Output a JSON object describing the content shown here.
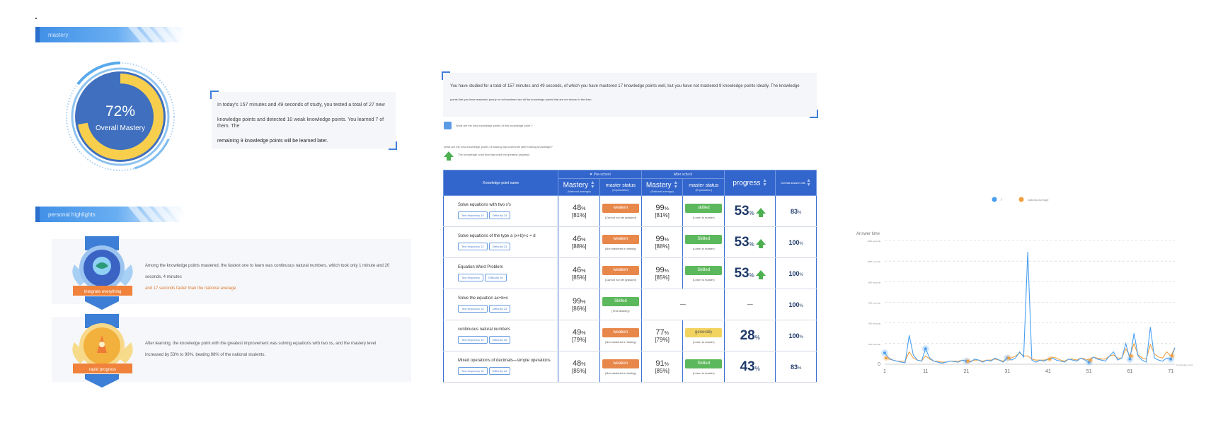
{
  "left": {
    "section1_title": "mastery",
    "gauge": {
      "value": "72%",
      "label": "Overall Mastery",
      "fraction": 0.72
    },
    "summary": [
      "In today's 157 minutes and 49 seconds of study, you tested a total of 27 new",
      "knowledge points and detected 10 weak knowledge points. You learned 7 of them. The",
      "remaining 9 knowledge points will be learned later."
    ],
    "section2_title": "personal highlights",
    "highlights": [
      {
        "badge": "Integrate everything",
        "text": [
          "Among the knowledge points mastered, the fastest one to learn was continuous natural numbers, which took only 1 minute and 20 seconds, 4 minutes",
          "and 17 seconds faster than the national average"
        ]
      },
      {
        "badge": "rapid progress",
        "text": [
          "After learning, the knowledge point with the greatest improvement was solving equations with two xs, and the mastery level",
          "increased by 53% to 99%, beating 98% of the national students."
        ]
      }
    ]
  },
  "middle": {
    "summary": [
      "You have studied for a total of 157 minutes and 49 seconds, of which you have mastered 17 knowledge points well, but you have not mastered 9 knowledge points ideally. The knowledge",
      "points that you have mastered poorly or not mastered are all the knowledge points that are not shown in the form."
    ],
    "legend": [
      "What are the new knowledge points of this knowledge point ?",
      "What are the new knowledge points of making improvements after making knowledge?",
      "The knowledge point that improved the greatest progress"
    ],
    "table": {
      "header_name": "Knowledge point name",
      "group_pre": "▼ Pre-school",
      "group_post": "After school",
      "mastery": "Mastery",
      "mastery_sub": "(National average)",
      "master_status": "master status",
      "master_status_sub": "(Explanation)",
      "progress": "progress",
      "last_col": "Overall answer rate",
      "rows": [
        {
          "name": "Solve equations with two x's",
          "tag1": "Test frequency 15",
          "tag2": "Difficulty 24",
          "pre_m": "48",
          "pre_n": "[81%]",
          "pre_s": "weaken",
          "pre_note": "(Cannot not yet grasped)",
          "post_m": "99",
          "post_n": "[81%]",
          "post_s": "skilled",
          "post_note": "(Learn to master)",
          "prog": "53",
          "arrow": true,
          "last": "83"
        },
        {
          "name": "Solve equations of the type a (x+b)+c = d",
          "tag1": "Test frequency 12",
          "tag2": "Difficulty 23",
          "pre_m": "46",
          "pre_n": "[88%]",
          "pre_s": "weaken",
          "pre_note": "(Not mastered in testing)",
          "post_m": "99",
          "post_n": "[88%]",
          "post_s": "Skilled",
          "post_note": "(Learn to master)",
          "prog": "53",
          "arrow": true,
          "last": "100"
        },
        {
          "name": "Equation Word Problem",
          "tag1": "Test frequency",
          "tag2": "Difficulty 46",
          "pre_m": "46",
          "pre_n": "[85%]",
          "pre_s": "weaken",
          "pre_note": "(Cannot not yet grasped)",
          "post_m": "99",
          "post_n": "[85%]",
          "post_s": "Skilled",
          "post_note": "(Learn to master)",
          "prog": "53",
          "arrow": true,
          "last": "100"
        },
        {
          "name": "Solve the equation ax+b=c",
          "tag1": "Test frequency 10",
          "tag2": "Difficulty 23",
          "pre_m": "99",
          "pre_n": "[86%]",
          "pre_s": "Skilled",
          "pre_note": "(Test Mastery)",
          "post_m": "",
          "post_n": "",
          "post_s": "",
          "post_note": "",
          "prog": "—",
          "arrow": false,
          "last": "100",
          "post_dash": "—"
        },
        {
          "name": "continuous natural numbers",
          "tag1": "Test frequency 10",
          "tag2": "Difficulty 18",
          "pre_m": "49",
          "pre_n": "[79%]",
          "pre_s": "weaken",
          "pre_note": "(Not mastered in testing)",
          "post_m": "77",
          "post_n": "[79%]",
          "post_s": "generally",
          "post_note": "(Learn to master)",
          "prog": "28",
          "arrow": false,
          "last": "100"
        },
        {
          "name": "Mixed operations of decimals—simple operations",
          "tag1": "Test frequency 15",
          "tag2": "Difficulty 23",
          "pre_m": "48",
          "pre_n": "[85%]",
          "pre_s": "weaken",
          "pre_note": "(Not mastered in testing)",
          "post_m": "91",
          "post_n": "[85%]",
          "post_s": "Skilled",
          "post_note": "(Learn to master)",
          "prog": "43",
          "arrow": false,
          "last": "83"
        }
      ]
    }
  },
  "chart_data": {
    "type": "line",
    "title": "Answer time",
    "legend": [
      "I",
      "national average"
    ],
    "x_ticks": [
      1,
      11,
      21,
      31,
      41,
      51,
      61,
      71
    ],
    "y_ticks": [
      "0",
      "200 seconds",
      "400 seconds",
      "600 seconds",
      "800 seconds",
      "1000 seconds",
      "1200 seconds"
    ],
    "ylim": [
      0,
      1200
    ],
    "xlim": [
      1,
      72
    ],
    "x_axis_note": "Knowledge points",
    "series": [
      {
        "name": "I",
        "color": "#4a9ff0",
        "values": [
          110,
          60,
          40,
          30,
          20,
          15,
          280,
          90,
          40,
          30,
          150,
          60,
          30,
          20,
          10,
          20,
          30,
          25,
          20,
          40,
          30,
          20,
          50,
          40,
          20,
          40,
          30,
          60,
          40,
          20,
          60,
          40,
          60,
          120,
          70,
          1090,
          40,
          20,
          40,
          30,
          50,
          60,
          40,
          30,
          20,
          50,
          40,
          30,
          60,
          40,
          20,
          70,
          50,
          40,
          30,
          80,
          120,
          40,
          60,
          200,
          50,
          300,
          80,
          40,
          20,
          360,
          60,
          40,
          30,
          60,
          50,
          160
        ]
      },
      {
        "name": "national average",
        "color": "#f0a040",
        "values": [
          60,
          50,
          40,
          30,
          30,
          30,
          120,
          60,
          40,
          30,
          80,
          50,
          30,
          30,
          20,
          20,
          30,
          30,
          30,
          40,
          30,
          30,
          40,
          40,
          30,
          40,
          40,
          50,
          40,
          30,
          60,
          60,
          80,
          110,
          80,
          80,
          50,
          40,
          40,
          40,
          50,
          70,
          60,
          40,
          30,
          50,
          50,
          40,
          60,
          50,
          40,
          70,
          60,
          50,
          50,
          80,
          90,
          60,
          60,
          150,
          80,
          200,
          90,
          60,
          50,
          190,
          100,
          70,
          60,
          120,
          80,
          160
        ]
      }
    ]
  }
}
